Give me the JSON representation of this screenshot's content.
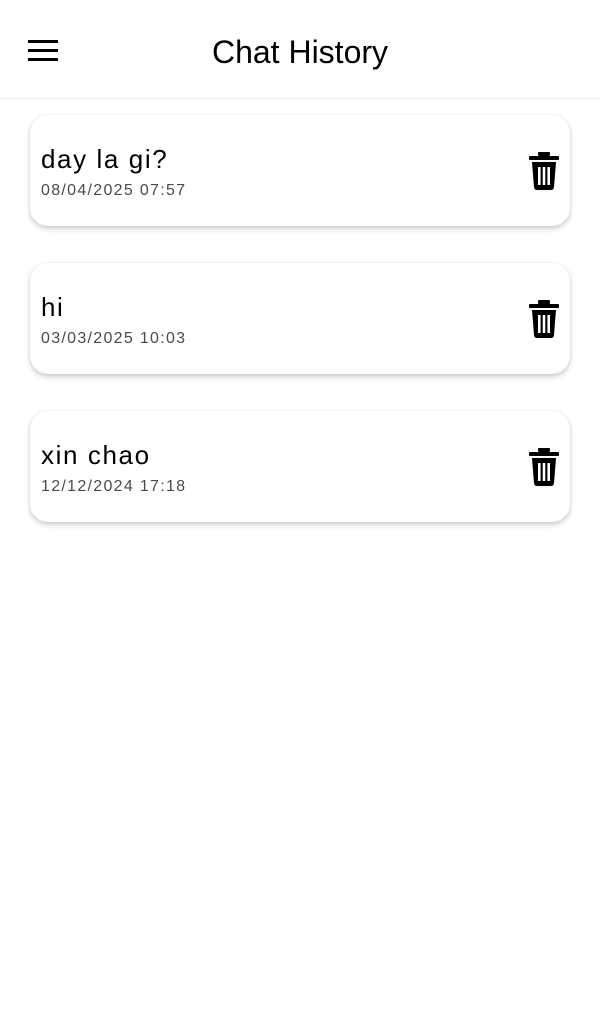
{
  "header": {
    "title": "Chat History",
    "menu_icon": "hamburger-menu-icon"
  },
  "chats": [
    {
      "title": "day la gi?",
      "timestamp": "08/04/2025 07:57",
      "delete_icon": "trash-icon"
    },
    {
      "title": "hi",
      "timestamp": "03/03/2025 10:03",
      "delete_icon": "trash-icon"
    },
    {
      "title": "xin chao",
      "timestamp": "12/12/2024 17:18",
      "delete_icon": "trash-icon"
    }
  ]
}
